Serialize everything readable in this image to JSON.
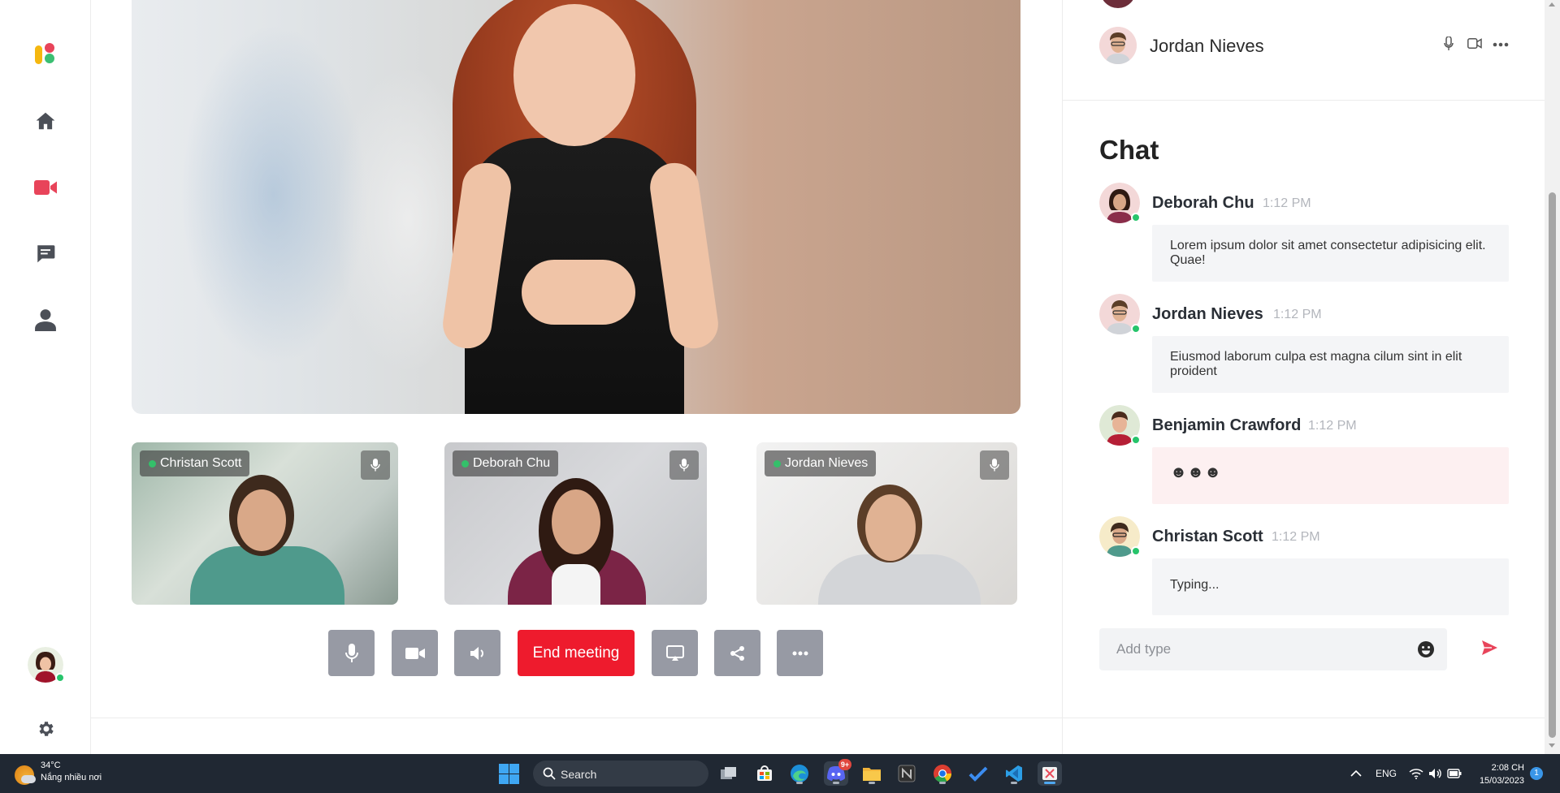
{
  "sidebar": {
    "items": [
      {
        "name": "home",
        "icon": "home-icon"
      },
      {
        "name": "video",
        "icon": "video-camera-icon",
        "active_color": "#e8445a"
      },
      {
        "name": "chat",
        "icon": "chat-icon"
      },
      {
        "name": "user",
        "icon": "user-icon"
      }
    ],
    "settings_icon": "gear-icon"
  },
  "participants": [
    {
      "name": "Christan Scott"
    },
    {
      "name": "Deborah Chu"
    },
    {
      "name": "Jordan Nieves"
    }
  ],
  "controls": {
    "end_meeting_label": "End meeting",
    "end_meeting_color": "#ee1b2d"
  },
  "right_panel": {
    "participant_name": "Jordan Nieves"
  },
  "chat": {
    "title": "Chat",
    "messages": [
      {
        "name": "Deborah Chu",
        "time": "1:12 PM",
        "text": "Lorem ipsum dolor sit amet consectetur adipisicing elit. Quae!"
      },
      {
        "name": "Jordan Nieves",
        "time": "1:12 PM",
        "text": "Eiusmod laborum culpa est magna cilum sint in elit proident"
      },
      {
        "name": "Benjamin Crawford",
        "time": "1:12 PM",
        "text": "☻☻☻"
      },
      {
        "name": "Christan Scott",
        "time": "1:12 PM",
        "text": "Typing..."
      }
    ],
    "input_placeholder": "Add type",
    "send_color": "#e8445a"
  },
  "taskbar": {
    "weather_temp": "34°C",
    "weather_desc": "Nắng nhiều nơi",
    "search_label": "Search",
    "discord_badge": "9+",
    "language": "ENG",
    "time": "2:08 CH",
    "date": "15/03/2023",
    "notification_count": "1"
  }
}
